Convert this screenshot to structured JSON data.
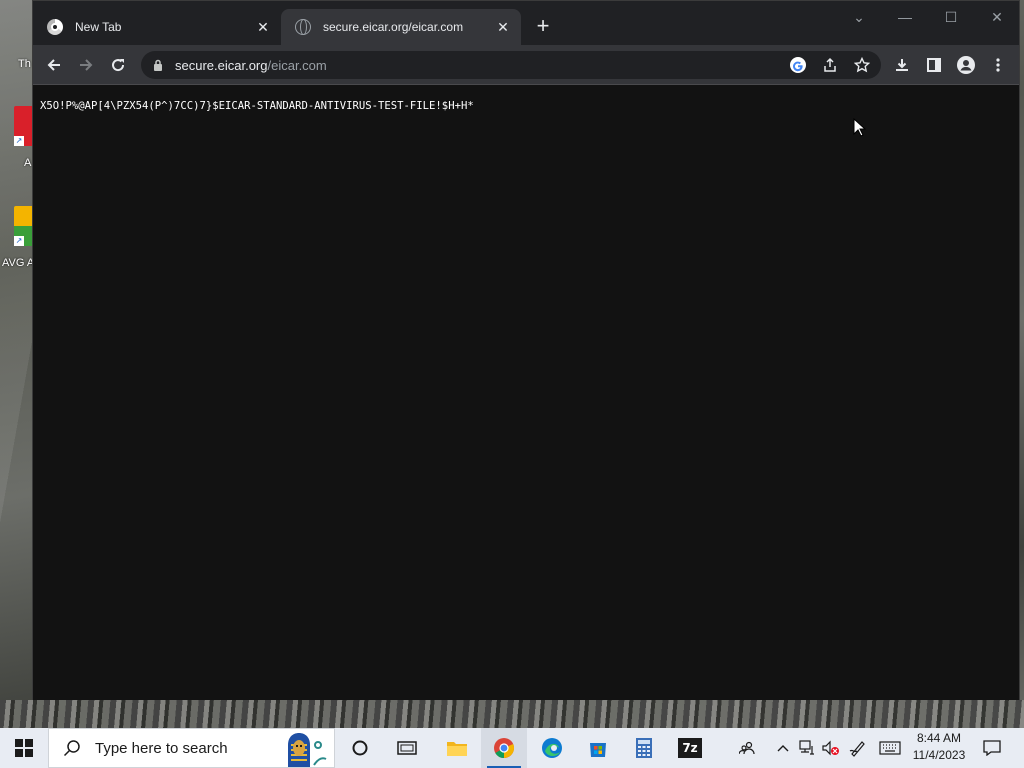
{
  "browser": {
    "tabs": [
      {
        "title": "New Tab",
        "favicon": "chrome-icon",
        "active": false
      },
      {
        "title": "secure.eicar.org/eicar.com",
        "favicon": "globe-icon",
        "active": true
      }
    ],
    "address": {
      "host": "secure.eicar.org",
      "path": "/eicar.com"
    },
    "page_text": "X5O!P%@AP[4\\PZX54(P^)7CC)7}$EICAR-STANDARD-ANTIVIRUS-TEST-FILE!$H+H*"
  },
  "desktop": {
    "icons": [
      {
        "label": "A",
        "icon": "adobe-icon"
      },
      {
        "label": "AVG A",
        "icon": "avg-icon"
      }
    ],
    "partial_label": "Th"
  },
  "taskbar": {
    "search_placeholder": "Type here to search",
    "time": "8:44 AM",
    "date": "11/4/2023",
    "apps": [
      "cortana-icon",
      "task-view-icon",
      "file-explorer-icon",
      "chrome-icon",
      "edge-icon",
      "store-icon",
      "calculator-icon",
      "7zip-icon"
    ],
    "seven_zip_label": "7z"
  },
  "colors": {
    "page_background": "#121212",
    "tabstrip": "#202124",
    "active_tab": "#35363a",
    "taskbar": "#e8ecf3"
  }
}
